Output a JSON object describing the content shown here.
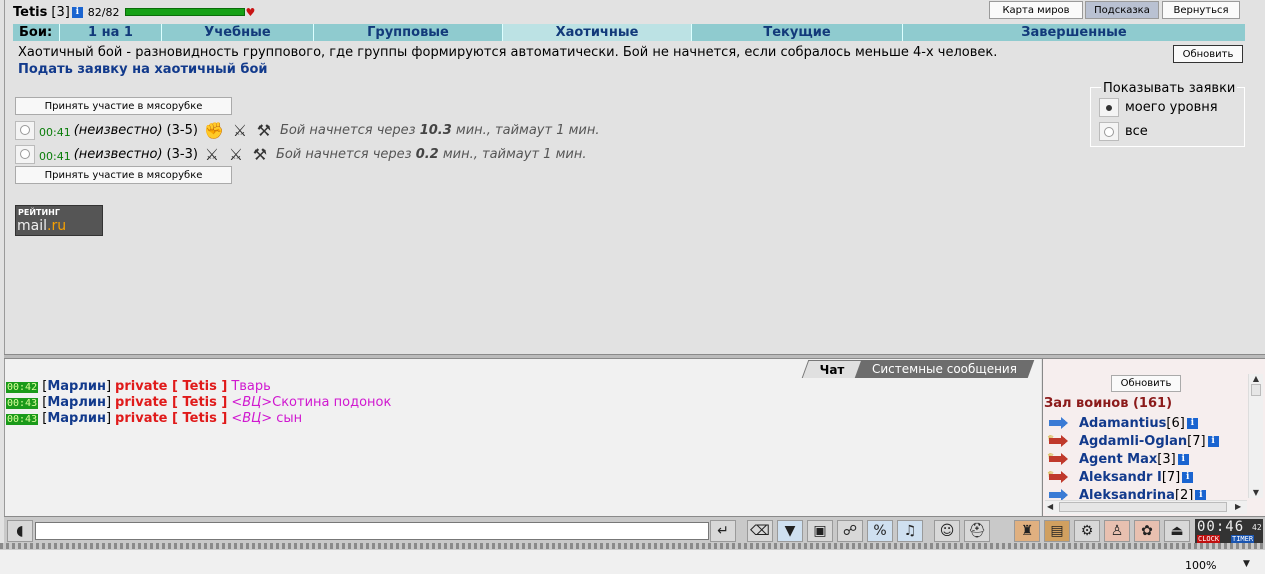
{
  "header": {
    "nick": "Tetis",
    "level": "[3]",
    "info_icon": "i",
    "hp_text": "82/82",
    "hp_fraction": 1.0
  },
  "top_buttons": {
    "map": "Карта миров",
    "hint": "Подсказка",
    "back": "Вернуться"
  },
  "tabs": {
    "label": "Бои:",
    "items": [
      {
        "label": "1 на 1"
      },
      {
        "label": "Учебные"
      },
      {
        "label": "Групповые"
      },
      {
        "label": "Хаотичные"
      },
      {
        "label": "Текущие"
      },
      {
        "label": "Завершенные"
      }
    ],
    "active": "Хаотичные"
  },
  "main": {
    "description": "Хаотичный бой - разновидность группового, где группы формируются автоматически. Бой не начнется, если собралось меньше 4-х человек.",
    "apply_link": "Подать заявку на хаотичный бой",
    "refresh": "Обновить",
    "meat_button": "Принять участие в мясорубке",
    "rows": [
      {
        "time": "00:41",
        "who": "(неизвестно)",
        "count": "(3-5)",
        "status_pre": "Бой начнется через ",
        "status_val": "10.3",
        "status_post": " мин., таймаут 1 мин."
      },
      {
        "time": "00:41",
        "who": "(неизвестно)",
        "count": "(3-3)",
        "status_pre": "Бой начнется через ",
        "status_val": "0.2",
        "status_post": " мин., таймаут 1 мин."
      }
    ],
    "rating": {
      "top": "РЕЙТИНГ",
      "brand_a": "mail",
      "brand_b": ".ru"
    },
    "show_box": {
      "legend": "Показывать заявки",
      "options": [
        {
          "label": "моего уровня",
          "selected": true
        },
        {
          "label": "все",
          "selected": false
        }
      ]
    }
  },
  "chat": {
    "tabs": {
      "chat": "Чат",
      "system": "Системные сообщения"
    },
    "messages": [
      {
        "time": "00:42",
        "lb": "[",
        "from": "Марлин",
        "rb": "]",
        "private": "private [ Tetis ]",
        "text": "Тварь",
        "italic": ""
      },
      {
        "time": "00:43",
        "lb": "[",
        "from": "Марлин",
        "rb": "]",
        "private": "private [ Tetis ]",
        "text": "Скотина подонок",
        "italic": ""
      },
      {
        "time": "00:43",
        "lb": "[",
        "from": "Марлин",
        "rb": "]",
        "private": "private [ Tetis ]",
        "text": " сын",
        "italic": "<ВЦ>"
      }
    ]
  },
  "hall": {
    "refresh": "Обновить",
    "title": "Зал воинов (161)",
    "warriors": [
      {
        "name": "Adamantius",
        "level": "[6]"
      },
      {
        "name": "Agdamli-Oglan",
        "level": "[7]"
      },
      {
        "name": "Agent Max",
        "level": "[3]"
      },
      {
        "name": "Aleksandr I",
        "level": "[7]"
      },
      {
        "name": "Aleksandrina",
        "level": "[2]"
      }
    ]
  },
  "toolbar": {
    "clock_time": "00:46",
    "clock_sec": "42",
    "clock_label": "CLOCK",
    "timer_label": "TIMER"
  },
  "statusbar": {
    "zoom": "100%"
  }
}
